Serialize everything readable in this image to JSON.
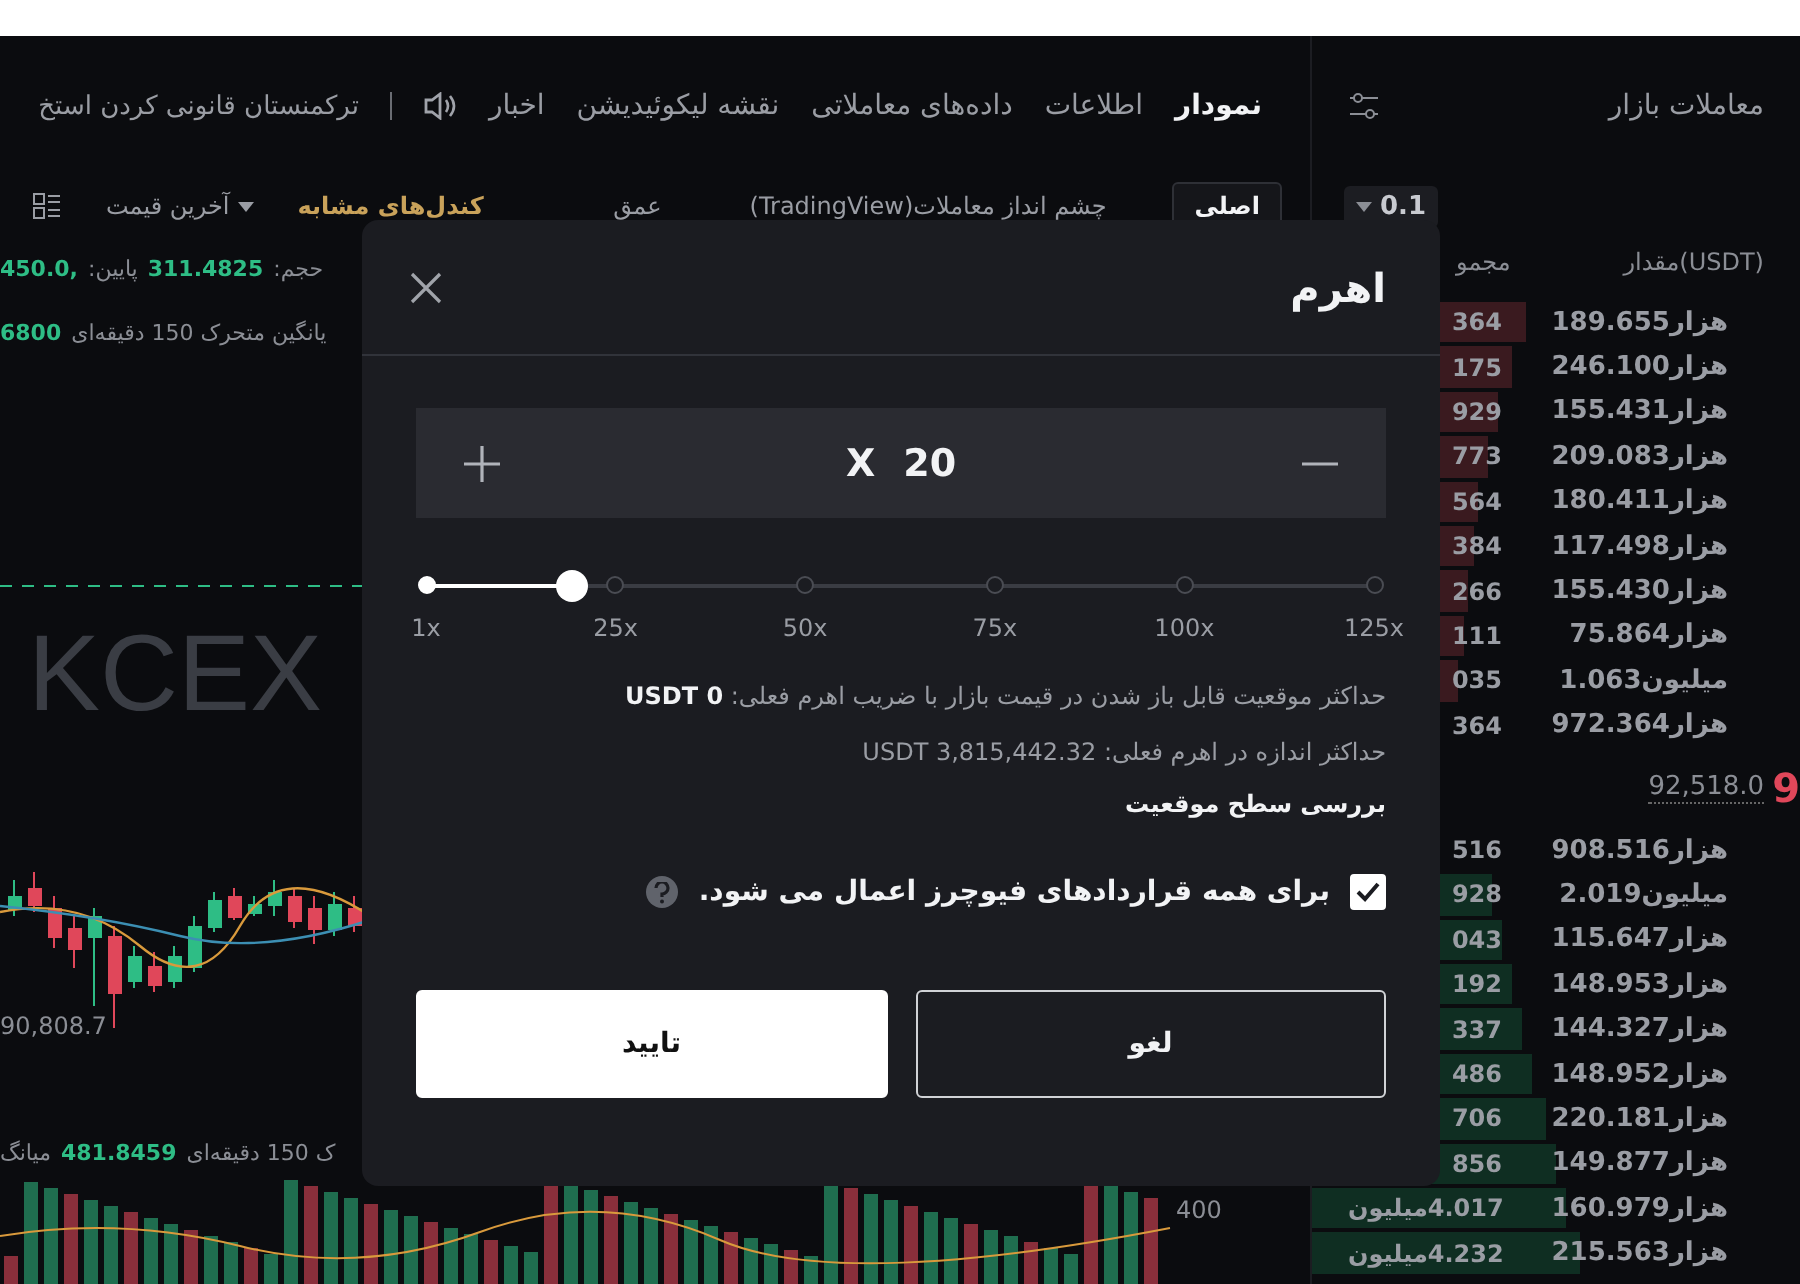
{
  "nav": {
    "tabs": [
      {
        "label": "نمودار",
        "selected": true
      },
      {
        "label": "اطلاعات",
        "selected": false
      },
      {
        "label": "داده‌های معاملاتی",
        "selected": false
      },
      {
        "label": "نقشه لیکوئیدیشن",
        "selected": false
      },
      {
        "label": "اخبار",
        "selected": false
      }
    ],
    "news_ticker": "ترکمنستان قانونی کردن استخ"
  },
  "chart_toolbar": {
    "views": [
      {
        "label": "اصلی",
        "selected": true
      },
      {
        "label": "چشم انداز معاملات(TradingView)",
        "selected": false
      },
      {
        "label": "عمق",
        "selected": false
      }
    ],
    "candle_type": "کندل‌های مشابه",
    "price_type": "آخرین قیمت"
  },
  "chart": {
    "legend": [
      [
        {
          "kind": "label",
          "text": "حجم:"
        },
        {
          "kind": "value",
          "text": "311.4825"
        },
        {
          "kind": "label",
          "text": "پایین:"
        },
        {
          "kind": "value",
          "text": ",450.0"
        }
      ],
      [
        {
          "kind": "label",
          "text": "یانگین متحرک 150 دقیقه‌ای"
        },
        {
          "kind": "value",
          "text": "6800"
        }
      ]
    ],
    "watermark_text": "KCEX",
    "low_marker": "90,808.7",
    "volume_legend": [
      {
        "kind": "label",
        "text": "ک 150 دقیقه‌ای"
      },
      {
        "kind": "value",
        "text": "481.8459"
      },
      {
        "kind": "label",
        "text": "میانگ"
      }
    ],
    "axis_label": "400"
  },
  "market_trades": {
    "title": "معاملات بازار"
  },
  "order_book": {
    "step": "0.1",
    "columns": [
      "مقدار(USDT)",
      "مجمو"
    ],
    "asks": [
      {
        "total": "364",
        "amount": "189.655هزار",
        "level": 0.44
      },
      {
        "total": "175",
        "amount": "246.100هزار",
        "level": 0.41
      },
      {
        "total": "929",
        "amount": "155.431هزار",
        "level": 0.38
      },
      {
        "total": "773",
        "amount": "209.083هزار",
        "level": 0.36
      },
      {
        "total": "564",
        "amount": "180.411هزار",
        "level": 0.34
      },
      {
        "total": "384",
        "amount": "117.498هزار",
        "level": 0.33
      },
      {
        "total": "266",
        "amount": "155.430هزار",
        "level": 0.32
      },
      {
        "total": "111",
        "amount": "75.864هزار",
        "level": 0.31
      },
      {
        "total": "035",
        "amount": "1.063میلیون",
        "level": 0.3
      },
      {
        "total": "364",
        "amount": "972.364هزار"
      }
    ],
    "mid_price": "92,518.0",
    "last_price": "9",
    "bids": [
      {
        "total": "516",
        "amount": "908.516هزار"
      },
      {
        "total": "928",
        "amount": "2.019میلیون",
        "level": 0.37
      },
      {
        "total": "043",
        "amount": "115.647هزار",
        "level": 0.39
      },
      {
        "total": "192",
        "amount": "148.953هزار",
        "level": 0.41
      },
      {
        "total": "337",
        "amount": "144.327هزار",
        "level": 0.43
      },
      {
        "total": "486",
        "amount": "148.952هزار",
        "level": 0.45
      },
      {
        "total": "706",
        "amount": "220.181هزار",
        "level": 0.48
      },
      {
        "total": "856",
        "amount": "149.877هزار",
        "level": 0.5
      },
      {
        "total": "4.017میلیون",
        "amount": "160.979هزار",
        "level": 0.52
      },
      {
        "total": "4.232میلیون",
        "amount": "215.563هزار",
        "level": 0.55
      }
    ]
  },
  "leverage_dialog": {
    "title": "اهرم",
    "multiplier_prefix": "X",
    "value": "20",
    "slider": {
      "level": 0.153,
      "ticks": [
        "125x",
        "100x",
        "75x",
        "50x",
        "25x",
        "1x"
      ]
    },
    "info": [
      {
        "kind": "muted",
        "text": "حداکثر موقعیت قابل باز شدن در قیمت بازار با ضریب اهرم فعلی: **USDT 0**"
      },
      {
        "kind": "muted",
        "text": "حداکثر اندازه در اهرم فعلی: USDT 3,815,442.32"
      },
      {
        "kind": "link",
        "text": "بررسی سطح موقعیت"
      }
    ],
    "apply_all": {
      "label": "برای همه قراردادهای فیوچرز اعمال می شود.",
      "checked": true
    },
    "buttons": [
      {
        "label": "لغو",
        "kind": "secondary"
      },
      {
        "label": "تایید",
        "kind": "primary"
      }
    ]
  }
}
